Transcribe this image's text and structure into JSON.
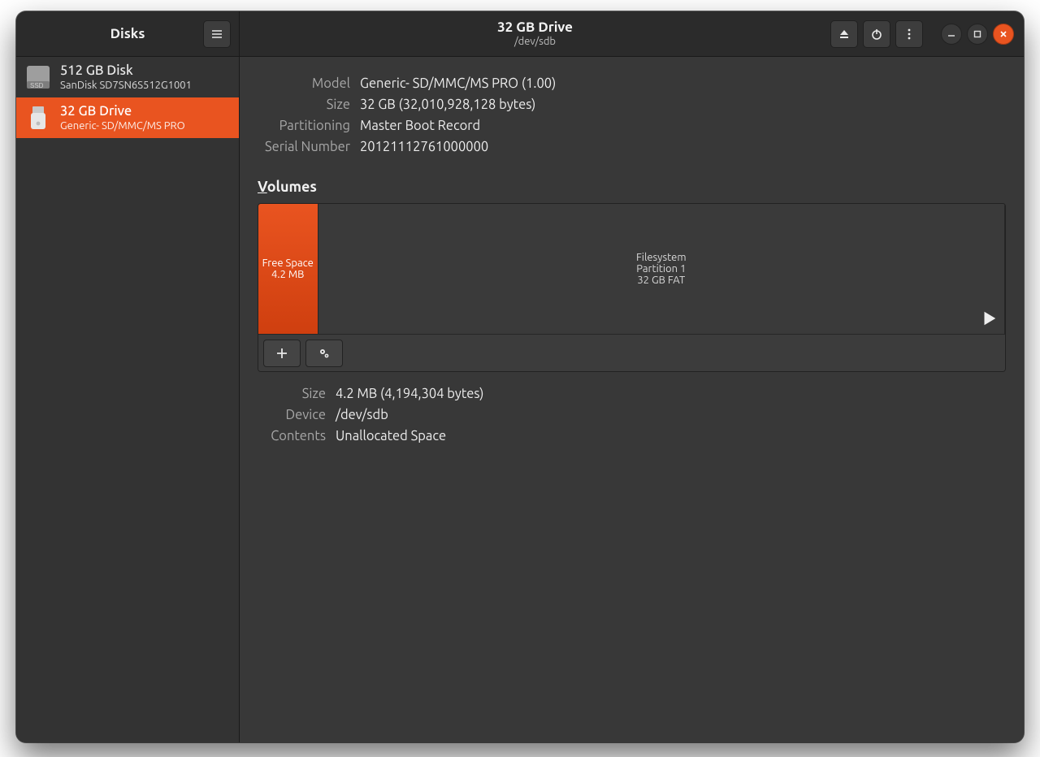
{
  "app": {
    "title": "Disks"
  },
  "header": {
    "title": "32 GB Drive",
    "subtitle": "/dev/sdb"
  },
  "drives": [
    {
      "primary": "512 GB Disk",
      "secondary": "SanDisk SD7SN6S512G1001",
      "icon": "ssd",
      "selected": false
    },
    {
      "primary": "32 GB Drive",
      "secondary": "Generic- SD/MMC/MS PRO",
      "icon": "usb",
      "selected": true
    }
  ],
  "info": {
    "model_label": "Model",
    "model_value": "Generic- SD/MMC/MS PRO (1.00)",
    "size_label": "Size",
    "size_value": "32 GB (32,010,928,128 bytes)",
    "part_label": "Partitioning",
    "part_value": "Master Boot Record",
    "serial_label": "Serial Number",
    "serial_value": "20121112761000000"
  },
  "volumes_section": {
    "title_accesskey": "V",
    "title_rest": "olumes"
  },
  "volumes": [
    {
      "line1": "Free Space",
      "line2": "4.2 MB",
      "line3": "",
      "selected": true,
      "width_pct": 8,
      "mountable": false
    },
    {
      "line1": "Filesystem",
      "line2": "Partition 1",
      "line3": "32 GB FAT",
      "selected": false,
      "width_pct": 92,
      "mountable": true
    }
  ],
  "selected_volume": {
    "size_label": "Size",
    "size_value": "4.2 MB (4,194,304 bytes)",
    "device_label": "Device",
    "device_value": "/dev/sdb",
    "contents_label": "Contents",
    "contents_value": "Unallocated Space"
  }
}
